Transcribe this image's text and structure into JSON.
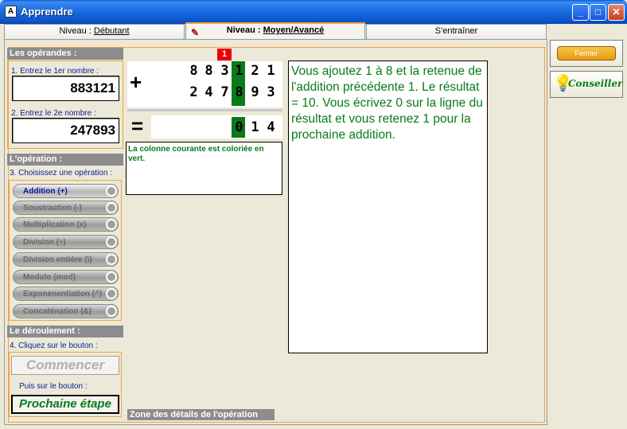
{
  "window": {
    "title": "Apprendre",
    "icon": "app-icon"
  },
  "tabs": {
    "debutant": {
      "prefix": "Niveau : ",
      "name": "Débutant"
    },
    "moyen": {
      "prefix": "Niveau : ",
      "name": "Moyen/Avancé"
    },
    "entrainer": "S'entraîner"
  },
  "operandes": {
    "header": "Les opérandes :",
    "label1": "1. Entrez le 1er nombre :",
    "value1": "883121",
    "label2": "2. Entrez le 2e nombre :",
    "value2": "247893"
  },
  "operation": {
    "header": "L'opération :",
    "instruction": "3. Choisissez une opération :",
    "buttons": [
      "Addition (+)",
      "Soustraction (-)",
      "Multiplication (x)",
      "Division (÷)",
      "Division entière (\\)",
      "Modulo (mod)",
      "Exponenentiation (^)",
      "Concaténation (&)"
    ]
  },
  "deroulement": {
    "header": "Le déroulement :",
    "instruction": "4. Cliquez sur le bouton :",
    "start_label": "Commencer",
    "then_label": "Puis sur le bouton :",
    "next_label": "Prochaine étape"
  },
  "calc": {
    "carry": "1",
    "plus": "+",
    "equals": "=",
    "row1": [
      "8",
      "8",
      "3",
      "1",
      "2",
      "1"
    ],
    "row2": [
      "2",
      "4",
      "7",
      "8",
      "9",
      "3"
    ],
    "result": [
      "0",
      "1",
      "4"
    ]
  },
  "hint": "La colonne courante est coloriée en vert.",
  "explanation": "Vous ajoutez 1 à 8 et la retenue de l'addition précédente 1. Le résultat = 10. Vous écrivez 0 sur la ligne du résultat et vous retenez 1 pour la prochaine addition.",
  "zone_label": "Zone des détails de l'opération",
  "right": {
    "fermer": "Fermer",
    "conseiller": "Conseiller"
  }
}
